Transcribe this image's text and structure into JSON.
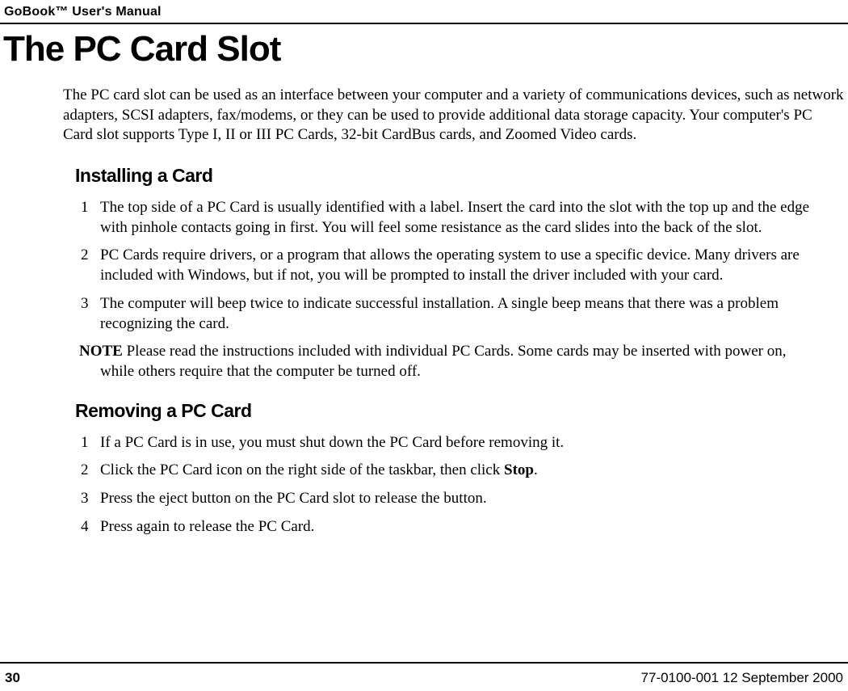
{
  "header": {
    "title": "GoBook™ User's Manual"
  },
  "main_title": "The PC Card Slot",
  "intro": "The PC card slot can be used as an interface between your computer and a variety of communications devices, such as network adapters, SCSI adapters, fax/modems, or they can be used to provide additional data storage capacity. Your computer's PC Card slot supports Type I, II or III  PC Cards, 32-bit CardBus cards, and Zoomed Video cards.",
  "section1": {
    "title": "Installing a Card",
    "items": [
      {
        "num": "1",
        "text": "The top side of a PC Card is usually identified with a label. Insert the card into the slot with the top up and the edge with pinhole contacts going in first. You will feel some resistance as the card slides into the back of the slot."
      },
      {
        "num": "2",
        "text": "PC Cards require drivers, or a program that allows the operating system to use a specific device. Many drivers are included with Windows, but if not, you will be prompted to install the driver included with your card."
      },
      {
        "num": "3",
        "text": "The computer will beep twice to indicate successful installation. A single beep means that there was a problem recognizing the card."
      }
    ],
    "note_label": "NOTE",
    "note_line1": "  Please read the instructions included with individual PC Cards. Some cards may be inserted with power on,",
    "note_line2": "while others require that the computer be turned off."
  },
  "section2": {
    "title": "Removing a PC Card",
    "items": [
      {
        "num": "1",
        "text": "If a PC Card is in use, you must shut down the PC Card before removing it."
      },
      {
        "num": "2",
        "text_before": "Click the PC Card icon on the right side of the taskbar, then click ",
        "bold": "Stop",
        "text_after": "."
      },
      {
        "num": "3",
        "text": "Press the eject button on the PC Card slot to release the button."
      },
      {
        "num": "4",
        "text": "Press again to release the PC Card."
      }
    ]
  },
  "footer": {
    "page_number": "30",
    "doc_info": "77-0100-001   12 September 2000"
  }
}
